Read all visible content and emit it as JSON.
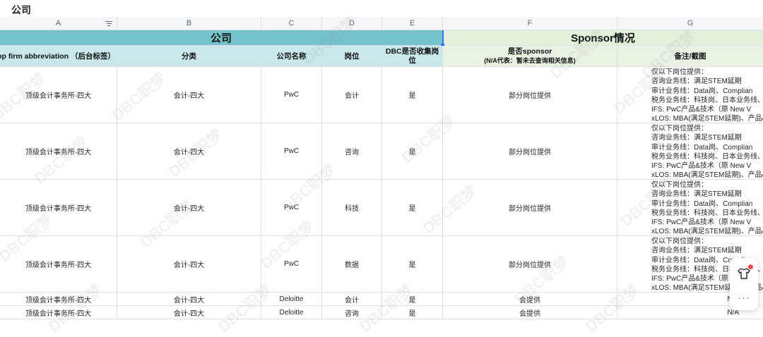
{
  "sheet_title": "公司",
  "columns": [
    "A",
    "B",
    "C",
    "D",
    "E",
    "F",
    "G"
  ],
  "band": {
    "company": "公司",
    "sponsor": "Sponsor情况"
  },
  "headers": {
    "a": "op firm abbreviation （后台标签）",
    "b": "分类",
    "c": "公司名称",
    "d": "岗位",
    "e": "DBC是否收集岗位",
    "f_main": "是否sponsor",
    "f_sub": "(N/A代表：暂未去查询相关信息)",
    "g": "备注/截图"
  },
  "notes_lines": [
    "仅以下岗位提供：",
    "咨询业务线：满足STEM延期",
    "审计业务线：Data岗、Complian",
    "税务业务线：科技岗、日本业务线、",
    "IFS: PwC产品&技术（原 New V",
    "xLOS: MBA(满足STEM延期)、产品&技"
  ],
  "rows": [
    {
      "a": "顶级会计事务所-四大",
      "b": "会计-四大",
      "c": "PwC",
      "d": "会计",
      "e": "是",
      "f": "部分岗位提供",
      "g": ""
    },
    {
      "a": "顶级会计事务所-四大",
      "b": "会计-四大",
      "c": "PwC",
      "d": "咨询",
      "e": "是",
      "f": "部分岗位提供",
      "g": ""
    },
    {
      "a": "顶级会计事务所-四大",
      "b": "会计-四大",
      "c": "PwC",
      "d": "科技",
      "e": "是",
      "f": "部分岗位提供",
      "g": ""
    },
    {
      "a": "顶级会计事务所-四大",
      "b": "会计-四大",
      "c": "PwC",
      "d": "数据",
      "e": "是",
      "f": "部分岗位提供",
      "g": ""
    },
    {
      "a": "顶级会计事务所-四大",
      "b": "会计-四大",
      "c": "Deloitte",
      "d": "会计",
      "e": "是",
      "f": "会提供",
      "g": "N/A"
    },
    {
      "a": "顶级会计事务所-四大",
      "b": "会计-四大",
      "c": "Deloitte",
      "d": "咨询",
      "e": "是",
      "f": "会提供",
      "g": "N/A"
    }
  ],
  "watermark": "DBC职梦",
  "float_more": "···",
  "colors": {
    "company_band": "#74c2cb",
    "sponsor_band": "#e2f0dc",
    "header_blue": "#c8e8ec",
    "header_green": "#e8f3e3",
    "selection": "#3370ff"
  }
}
